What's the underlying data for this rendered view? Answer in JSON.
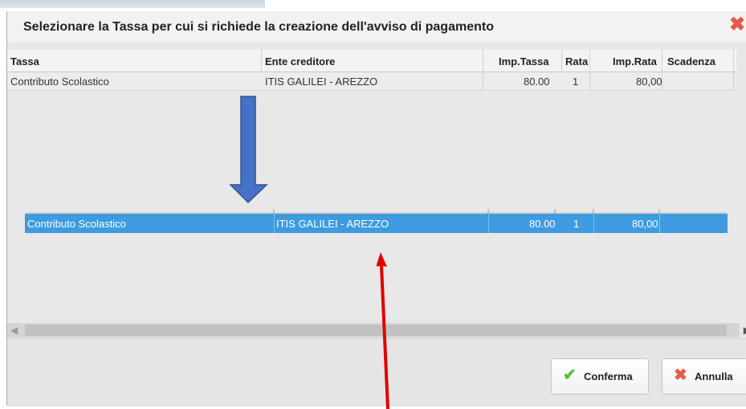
{
  "dialog": {
    "title": "Selezionare la Tassa per cui si richiede la creazione dell'avviso di pagamento",
    "close_icon": "close-icon"
  },
  "table": {
    "columns": [
      "Tassa",
      "Ente creditore",
      "Imp.Tassa",
      "Rata",
      "Imp.Rata",
      "Scadenza"
    ],
    "rows": [
      {
        "tassa": "Contributo Scolastico",
        "ente": "ITIS GALILEI - AREZZO",
        "imp_tassa": "80.00",
        "rata": "1",
        "imp_rata": "80,00",
        "scadenza": ""
      }
    ]
  },
  "selected_row": {
    "tassa": "Contributo Scolastico",
    "ente": "ITIS GALILEI - AREZZO",
    "imp_tassa": "80.00",
    "rata": "1",
    "imp_rata": "80,00",
    "scadenza": ""
  },
  "buttons": {
    "confirm_label": "Conferma",
    "cancel_label": "Annulla"
  },
  "colors": {
    "selection": "#3e9bdf",
    "annotation_arrow_blue": "#4472c4",
    "annotation_arrow_red": "#e00000",
    "confirm_check": "#5bbf3b",
    "cancel_x": "#e35b4b"
  }
}
